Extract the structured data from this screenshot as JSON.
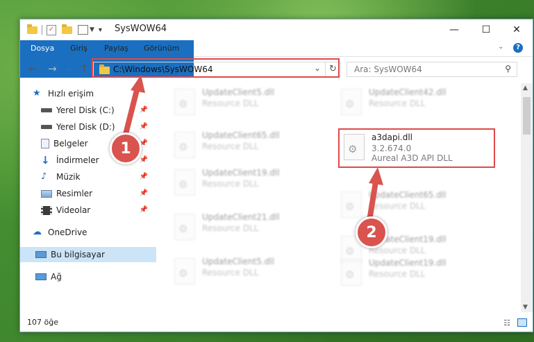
{
  "window": {
    "title": "SysWOW64",
    "minimize": "—",
    "maximize": "☐",
    "close": "✕"
  },
  "ribbon": {
    "tabs": [
      "Dosya",
      "Giriş",
      "Paylaş",
      "Görünüm"
    ]
  },
  "navigation": {
    "back": "←",
    "forward": "→",
    "recent": "⌄",
    "up": "↑",
    "address": "C:\\Windows\\SysWOW64",
    "search_placeholder": "Ara: SysWOW64"
  },
  "sidebar": {
    "items": [
      {
        "label": "Hızlı erişim",
        "icon": "star-icon"
      },
      {
        "label": "Yerel Disk (C:)",
        "icon": "drive-icon",
        "pinned": true
      },
      {
        "label": "Yerel Disk (D:)",
        "icon": "drive-icon",
        "pinned": true
      },
      {
        "label": "Belgeler",
        "icon": "documents-icon",
        "pinned": true
      },
      {
        "label": "İndirmeler",
        "icon": "download-icon",
        "pinned": true
      },
      {
        "label": "Müzik",
        "icon": "music-icon",
        "pinned": true
      },
      {
        "label": "Resimler",
        "icon": "pictures-icon",
        "pinned": true
      },
      {
        "label": "Videolar",
        "icon": "videos-icon",
        "pinned": true
      },
      {
        "label": "OneDrive",
        "icon": "cloud-icon"
      },
      {
        "label": "Bu bilgisayar",
        "icon": "computer-icon",
        "selected": true
      },
      {
        "label": "Ağ",
        "icon": "network-icon"
      }
    ]
  },
  "files": [
    {
      "name": "UpdateClient5.dll",
      "desc": "Resource DLL"
    },
    {
      "name": "UpdateClient42.dll",
      "desc": "Resource DLL"
    },
    {
      "name": "UpdateClient65.dll",
      "desc": "Resource DLL"
    },
    {
      "name": "UpdateClient19.dll",
      "desc": "Resource DLL"
    },
    {
      "name": "UpdateClient65.dll",
      "desc": "Resource DLL"
    },
    {
      "name": "UpdateClient21.dll",
      "desc": "Resource DLL"
    },
    {
      "name": "UpdateClient19.dll",
      "desc": "Resource DLL"
    },
    {
      "name": "UpdateClient5.dll",
      "desc": "Resource DLL"
    },
    {
      "name": "UpdateClient19.dll",
      "desc": "Resource DLL"
    }
  ],
  "highlighted_file": {
    "name": "a3dapi.dll",
    "version": "3.2.674.0",
    "desc": "Aureal A3D API DLL"
  },
  "status": {
    "count": "107 öğe"
  },
  "annotations": {
    "step1": "1",
    "step2": "2",
    "color": "#d9534f"
  }
}
